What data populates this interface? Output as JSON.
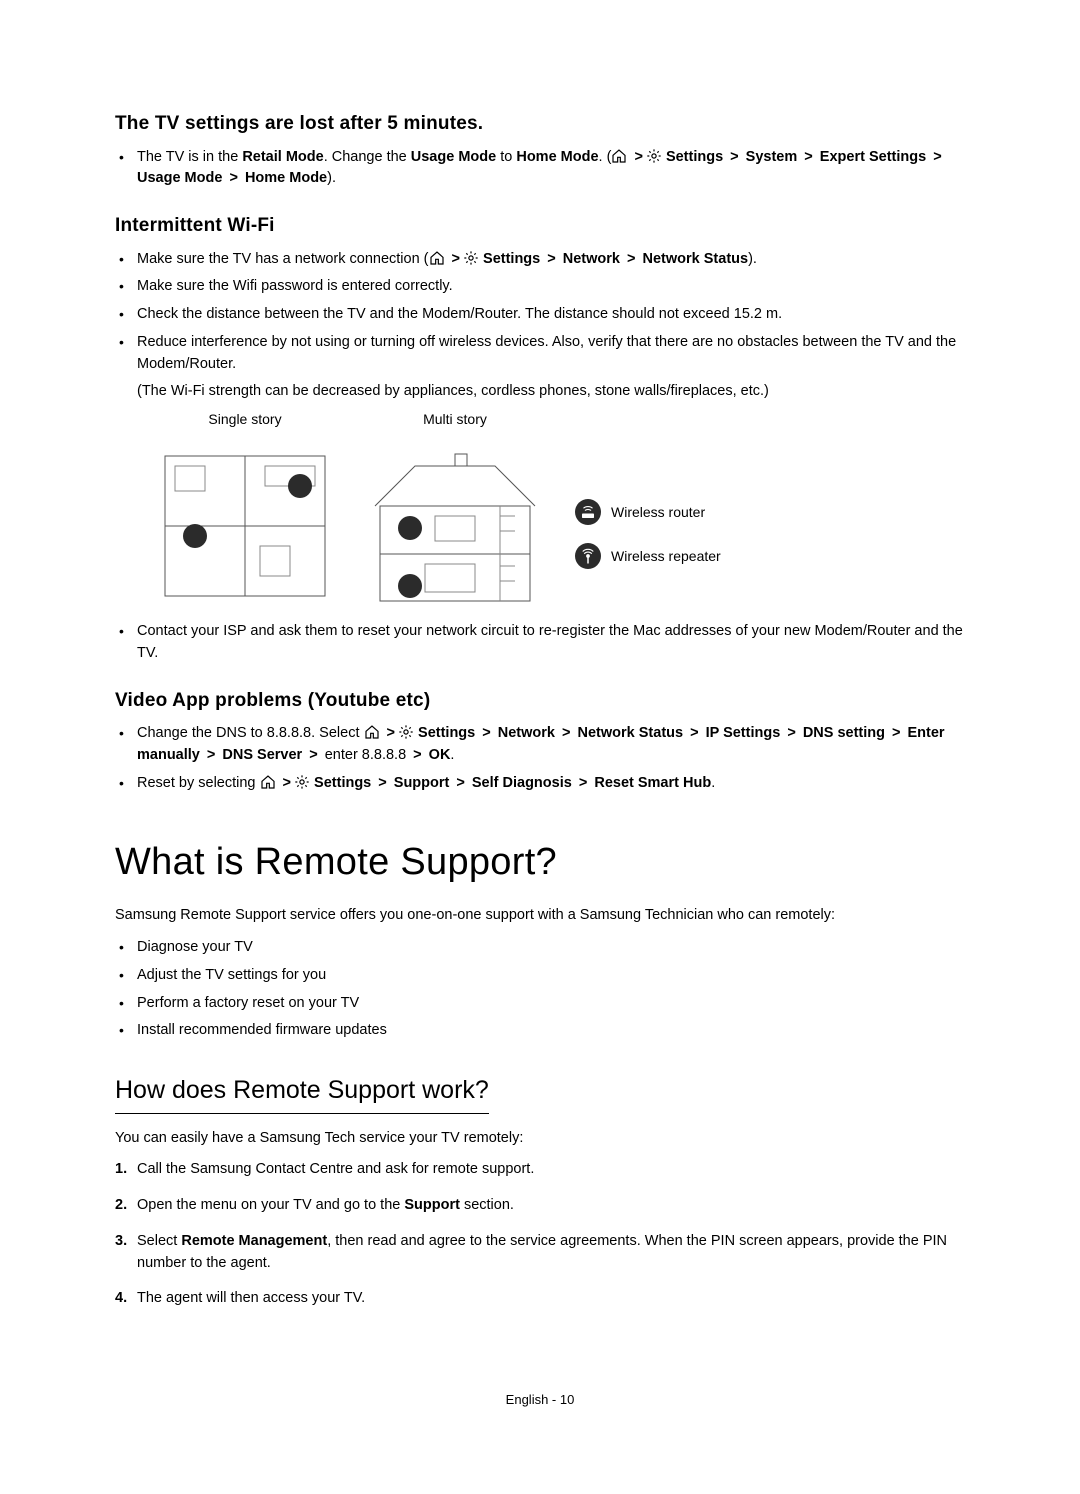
{
  "s1": {
    "title": "The TV settings are lost after 5 minutes.",
    "li1_a": "The TV is in the ",
    "li1_retail": "Retail Mode",
    "li1_b": ". Change the ",
    "li1_usage": "Usage Mode",
    "li1_c": " to ",
    "li1_home": "Home Mode",
    "li1_d": ". (",
    "path_settings": "Settings",
    "path_system": "System",
    "path_expert": "Expert Settings",
    "path_usage": "Usage Mode",
    "path_home": "Home Mode",
    "li1_e": ")."
  },
  "s2": {
    "title": "Intermittent Wi-Fi",
    "li1_a": "Make sure the TV has a network connection (",
    "path_settings": "Settings",
    "path_network": "Network",
    "path_status": "Network Status",
    "li1_b": ").",
    "li2": "Make sure the Wifi password is entered correctly.",
    "li3": "Check the distance between the TV and the Modem/Router. The distance should not exceed 15.2 m.",
    "li4": "Reduce interference by not using or turning off wireless devices. Also, verify that there are no obstacles between the TV and the Modem/Router.",
    "li4_note": "(The Wi-Fi strength can be decreased by appliances, cordless phones, stone walls/fireplaces, etc.)",
    "cap_single": "Single story",
    "cap_multi": "Multi story",
    "legend_router": "Wireless router",
    "legend_repeater": "Wireless repeater",
    "li5": "Contact your ISP and ask them to reset your network circuit to re-register the Mac addresses of your new Modem/Router and the TV."
  },
  "s3": {
    "title": "Video App problems (Youtube etc)",
    "li1_a": "Change the DNS to 8.8.8.8. Select ",
    "path_settings": "Settings",
    "path_network": "Network",
    "path_status": "Network Status",
    "path_ip": "IP Settings",
    "path_dns": "DNS setting",
    "path_enter": "Enter manually",
    "path_server": "DNS Server",
    "li1_b": "enter 8.8.8.8",
    "path_ok": "OK",
    "li2_a": "Reset by selecting ",
    "path_support": "Support",
    "path_self": "Self Diagnosis",
    "path_reset": "Reset Smart Hub"
  },
  "h1": "What is Remote Support?",
  "lead": "Samsung Remote Support service offers you one-on-one support with a Samsung Technician who can remotely:",
  "rs_items": {
    "a": "Diagnose your TV",
    "b": "Adjust the TV settings for you",
    "c": "Perform a factory reset on your TV",
    "d": "Install recommended firmware updates"
  },
  "h2": "How does Remote Support work?",
  "lead2": "You can easily have a Samsung Tech service your TV remotely:",
  "steps": {
    "1": "Call the Samsung Contact Centre and ask for remote support.",
    "2a": "Open the menu on your TV and go to the ",
    "2b": "Support",
    "2c": " section.",
    "3a": "Select ",
    "3b": "Remote Management",
    "3c": ", then read and agree to the service agreements. When the PIN screen appears, provide the PIN number to the agent.",
    "4": "The agent will then access your TV."
  },
  "footer": "English - 10",
  "sep": ">"
}
